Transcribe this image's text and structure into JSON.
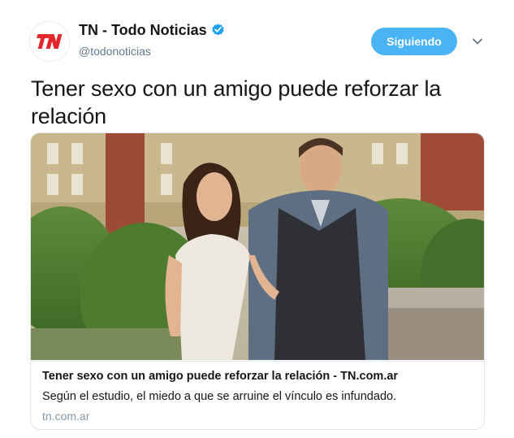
{
  "author": {
    "display_name": "TN - Todo Noticias",
    "handle": "@todonoticias",
    "avatar_logo_text": "TN",
    "verified": true
  },
  "follow_button": {
    "label": "Siguiendo"
  },
  "tweet": {
    "text": "Tener sexo con un amigo puede reforzar la relación"
  },
  "card": {
    "title": "Tener sexo con un amigo puede reforzar la relación - TN.com.ar",
    "description": "Según el estudio, el miedo a que se arruine el vínculo es infundado.",
    "domain": "tn.com.ar"
  },
  "colors": {
    "accent": "#4ab3f4",
    "verified": "#1da1f2",
    "brand_red": "#e3262b",
    "text_primary": "#14171a",
    "text_secondary": "#657786",
    "border": "#e1e8ed"
  }
}
